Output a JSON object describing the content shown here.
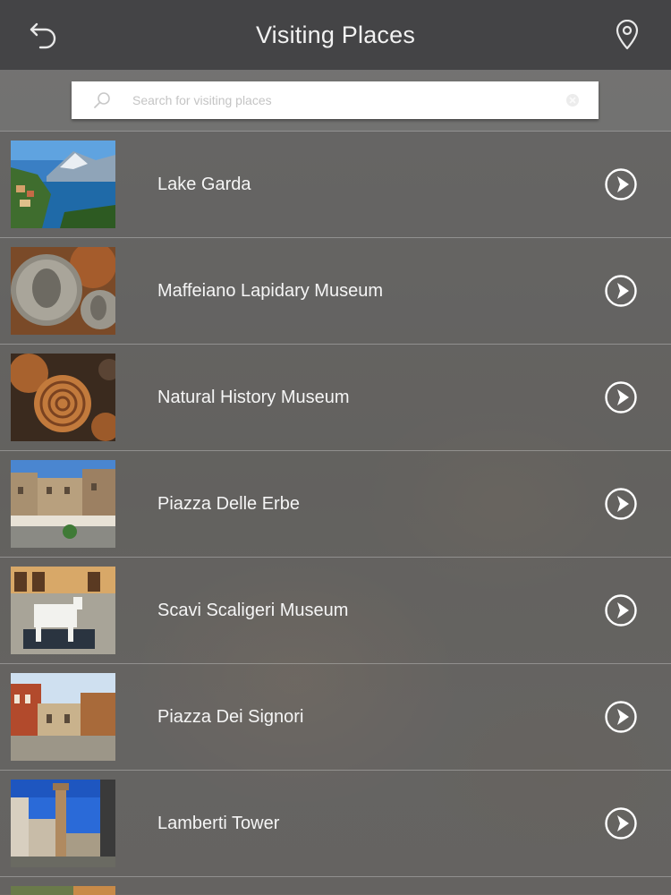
{
  "header": {
    "title": "Visiting Places",
    "back_icon": "back-arrow-icon",
    "location_icon": "map-pin-icon"
  },
  "search": {
    "placeholder": "Search for visiting places",
    "value": "",
    "icon": "search-icon",
    "clear_icon": "clear-icon"
  },
  "places": [
    {
      "name": "Lake Garda"
    },
    {
      "name": "Maffeiano Lapidary Museum"
    },
    {
      "name": "Natural History Museum"
    },
    {
      "name": "Piazza Delle Erbe"
    },
    {
      "name": "Scavi Scaligeri Museum"
    },
    {
      "name": "Piazza Dei Signori"
    },
    {
      "name": "Lamberti Tower"
    }
  ],
  "colors": {
    "header_bg": "#444446",
    "text": "#f5f5f5",
    "search_bg": "#ffffff"
  }
}
